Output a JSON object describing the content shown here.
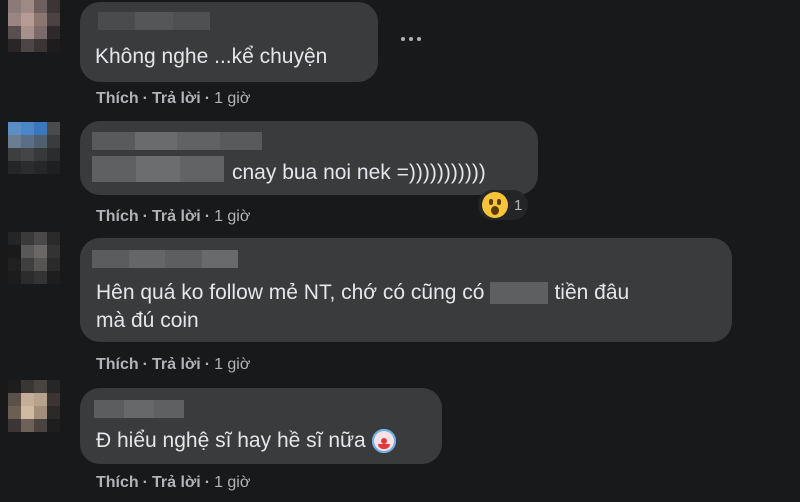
{
  "comments": [
    {
      "text": "Không nghe ...kể chuyện",
      "actions": {
        "like": "Thích",
        "reply": "Trả lời",
        "time": "1 giờ"
      }
    },
    {
      "text": "cnay bua noi nek =)))))))))))",
      "actions": {
        "like": "Thích",
        "reply": "Trả lời",
        "time": "1 giờ"
      },
      "reaction": {
        "icon": "wow-emoji-icon",
        "count": "1"
      }
    },
    {
      "text_line1_before": "Hên quá ko follow mẻ NT, chớ có cũng có",
      "text_line1_after": "tiền đâu",
      "text_line2": "mà đú coin",
      "actions": {
        "like": "Thích",
        "reply": "Trả lời",
        "time": "1 giờ"
      }
    },
    {
      "text": "Đ hiểu nghệ sĩ hay hề sĩ nữa",
      "emoji": "clown-face-icon",
      "actions": {
        "like": "Thích",
        "reply": "Trả lời",
        "time": "1 giờ"
      }
    }
  ],
  "separator": "·",
  "colors": {
    "background": "#18191a",
    "bubble": "#3a3b3c",
    "text": "#e4e6eb",
    "secondary_text": "#b0b3b8"
  }
}
